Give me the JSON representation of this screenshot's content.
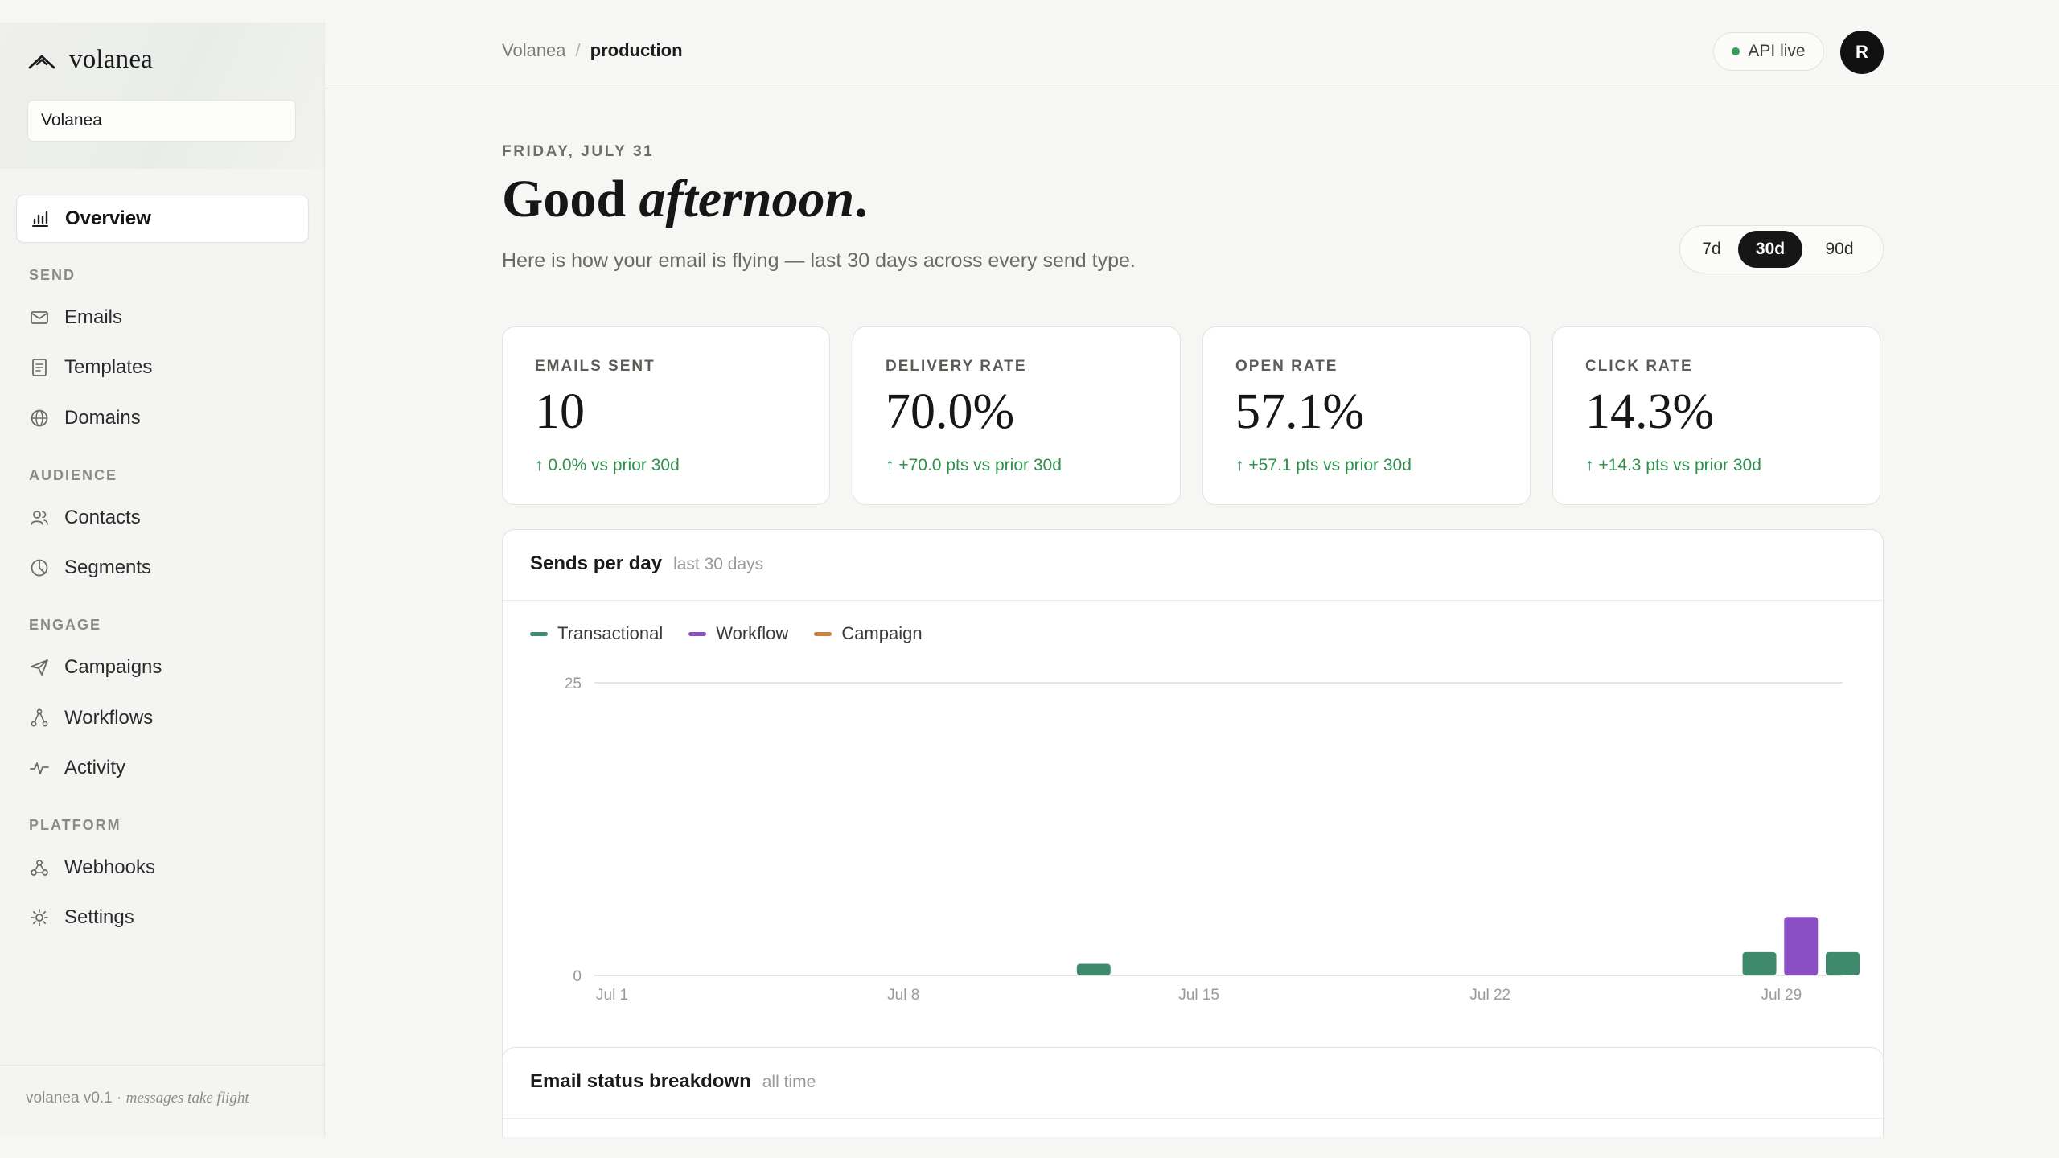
{
  "brand": {
    "name": "volanea"
  },
  "workspace": {
    "name": "Volanea"
  },
  "nav": {
    "overview": "Overview",
    "sections": {
      "send": "SEND",
      "audience": "AUDIENCE",
      "engage": "ENGAGE",
      "platform": "PLATFORM"
    },
    "items": {
      "emails": "Emails",
      "templates": "Templates",
      "domains": "Domains",
      "contacts": "Contacts",
      "segments": "Segments",
      "campaigns": "Campaigns",
      "workflows": "Workflows",
      "activity": "Activity",
      "webhooks": "Webhooks",
      "settings": "Settings"
    }
  },
  "footer": {
    "version": "volanea v0.1 · ",
    "tagline": "messages take flight"
  },
  "topbar": {
    "breadcrumb_root": "Volanea",
    "breadcrumb_sep": "/",
    "breadcrumb_current": "production",
    "api_status": "API live",
    "avatar_initial": "R"
  },
  "header": {
    "date": "FRIDAY, JULY 31",
    "greeting_plain": "Good ",
    "greeting_italic": "afternoon",
    "greeting_end": ".",
    "subtitle": "Here is how your email is flying — last 30 days across every send type."
  },
  "range": {
    "options": [
      "7d",
      "30d",
      "90d"
    ],
    "selected": "30d"
  },
  "kpis": [
    {
      "label": "EMAILS SENT",
      "value": "10",
      "delta": "↑ 0.0% vs prior 30d"
    },
    {
      "label": "DELIVERY RATE",
      "value": "70.0%",
      "delta": "↑ +70.0 pts vs prior 30d"
    },
    {
      "label": "OPEN RATE",
      "value": "57.1%",
      "delta": "↑ +57.1 pts vs prior 30d"
    },
    {
      "label": "CLICK RATE",
      "value": "14.3%",
      "delta": "↑ +14.3 pts vs prior 30d"
    }
  ],
  "sends_panel": {
    "title": "Sends per day",
    "subtitle": "last 30 days"
  },
  "status_panel": {
    "title": "Email status breakdown",
    "subtitle": "all time"
  },
  "colors": {
    "transactional": "#3f8a6d",
    "workflow": "#8a4fc4",
    "campaign": "#c7803e",
    "positive": "#2f8f4c"
  },
  "chart_data": {
    "type": "bar",
    "categories": [
      "Jul 1",
      "Jul 2",
      "Jul 3",
      "Jul 4",
      "Jul 5",
      "Jul 6",
      "Jul 7",
      "Jul 8",
      "Jul 9",
      "Jul 10",
      "Jul 11",
      "Jul 12",
      "Jul 13",
      "Jul 14",
      "Jul 15",
      "Jul 16",
      "Jul 17",
      "Jul 18",
      "Jul 19",
      "Jul 20",
      "Jul 21",
      "Jul 22",
      "Jul 23",
      "Jul 24",
      "Jul 25",
      "Jul 26",
      "Jul 27",
      "Jul 28",
      "Jul 29",
      "Jul 30",
      "Jul 31"
    ],
    "x_tick_labels": [
      "Jul 1",
      "Jul 8",
      "Jul 15",
      "Jul 22",
      "Jul 29"
    ],
    "series": [
      {
        "name": "Transactional",
        "values": [
          0,
          0,
          0,
          0,
          0,
          0,
          0,
          0,
          0,
          0,
          0,
          0,
          1,
          0,
          0,
          0,
          0,
          0,
          0,
          0,
          0,
          0,
          0,
          0,
          0,
          0,
          0,
          0,
          2,
          0,
          2
        ]
      },
      {
        "name": "Workflow",
        "values": [
          0,
          0,
          0,
          0,
          0,
          0,
          0,
          0,
          0,
          0,
          0,
          0,
          0,
          0,
          0,
          0,
          0,
          0,
          0,
          0,
          0,
          0,
          0,
          0,
          0,
          0,
          0,
          0,
          0,
          5,
          0
        ]
      },
      {
        "name": "Campaign",
        "values": [
          0,
          0,
          0,
          0,
          0,
          0,
          0,
          0,
          0,
          0,
          0,
          0,
          0,
          0,
          0,
          0,
          0,
          0,
          0,
          0,
          0,
          0,
          0,
          0,
          0,
          0,
          0,
          0,
          0,
          0,
          0
        ]
      }
    ],
    "ylim": [
      0,
      25
    ],
    "y_ticks": [
      "0",
      "25"
    ],
    "grid": true,
    "legend": "top-left"
  }
}
